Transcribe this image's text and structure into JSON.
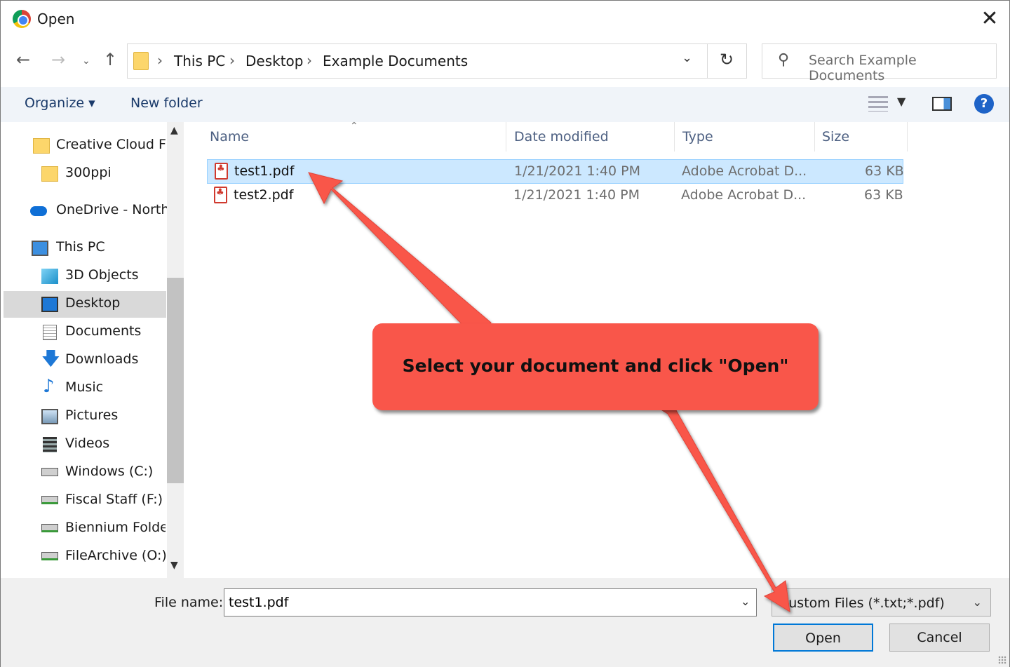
{
  "window": {
    "title": "Open"
  },
  "address": {
    "crumbs": [
      "This PC",
      "Desktop",
      "Example Documents"
    ],
    "search_placeholder": "Search Example Documents"
  },
  "toolbar": {
    "organize": "Organize ▾",
    "new_folder": "New folder",
    "help": "?"
  },
  "nav": {
    "items": [
      "Creative Cloud Fil",
      "300ppi",
      "OneDrive - North",
      "This PC",
      "3D Objects",
      "Desktop",
      "Documents",
      "Downloads",
      "Music",
      "Pictures",
      "Videos",
      "Windows (C:)",
      "Fiscal Staff (F:)",
      "Biennium Folder",
      "FileArchive (O:)"
    ]
  },
  "columns": {
    "name": "Name",
    "date": "Date modified",
    "type": "Type",
    "size": "Size"
  },
  "files": [
    {
      "name": "test1.pdf",
      "date": "1/21/2021 1:40 PM",
      "type": "Adobe Acrobat D...",
      "size": "63 KB"
    },
    {
      "name": "test2.pdf",
      "date": "1/21/2021 1:40 PM",
      "type": "Adobe Acrobat D...",
      "size": "63 KB"
    }
  ],
  "bottom": {
    "file_name_label": "File name:",
    "file_name_value": "test1.pdf",
    "file_type": "Custom Files (*.txt;*.pdf)",
    "open": "Open",
    "cancel": "Cancel"
  },
  "annotation": {
    "text": "Select your document and click \"Open\"",
    "color": "#f9564a"
  }
}
